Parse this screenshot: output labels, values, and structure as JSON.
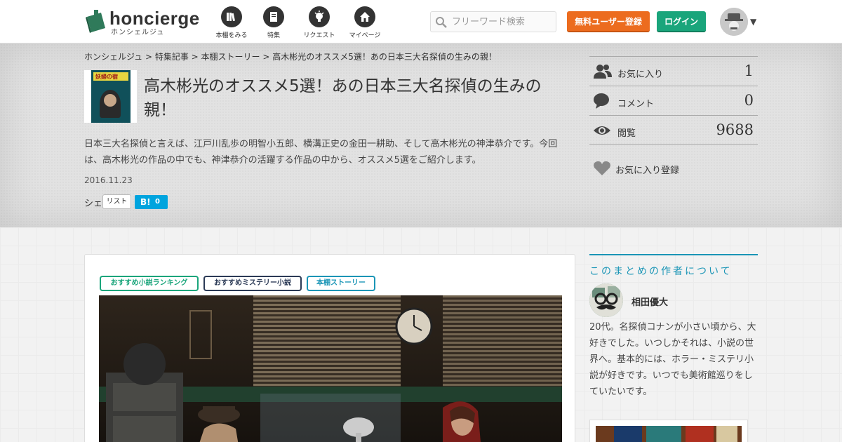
{
  "header": {
    "logo_text": "honcierge",
    "logo_sub": "ホンシェルジュ",
    "nav": [
      {
        "label": "本棚をみる",
        "icon": "books-icon"
      },
      {
        "label": "特集",
        "icon": "book-icon"
      },
      {
        "label": "リクエスト",
        "icon": "request-icon"
      },
      {
        "label": "マイページ",
        "icon": "home-icon"
      }
    ],
    "search_placeholder": "フリーワード検索",
    "register_label": "無料ユーザー登録",
    "login_label": "ログイン"
  },
  "breadcrumb": "ホンシェルジュ > 特集記事 > 本棚ストーリー > 高木彬光のオススメ5選！あの日本三大名探偵の生みの親！",
  "article": {
    "thumb_text": "妖婦の宿",
    "title": "高木彬光のオススメ5選！あの日本三大名探偵の生みの親！",
    "description": "日本三大名探偵と言えば、江戸川乱歩の明智小五郎、横溝正史の金田一耕助、そして高木彬光の神津恭介です。今回は、高木彬光の作品の中でも、神津恭介の活躍する作品の中から、オススメ5選をご紹介します。",
    "date": "2016.11.23",
    "share_label": "シェ",
    "list_label": "リスト",
    "hatena_label": "B!",
    "hatena_count": "0"
  },
  "stats": [
    {
      "label": "お気に入り",
      "value": "1",
      "icon": "users-icon"
    },
    {
      "label": "コメント",
      "value": "0",
      "icon": "comment-icon"
    },
    {
      "label": "閲覧",
      "value": "9688",
      "icon": "eye-icon"
    }
  ],
  "fav_register_label": "お気に入り登録",
  "tags": [
    "おすすめ小説ランキング",
    "おすすめミステリー小説",
    "本棚ストーリー"
  ],
  "author": {
    "heading": "このまとめの作者について",
    "name": "相田優大",
    "bio": "20代。名探偵コナンが小さい頃から、大好きでした。いつしかそれは、小説の世界へ。基本的には、ホラー・ミステリ小説が好きです。いつでも美術館巡りをしていたいです。"
  },
  "colors": {
    "register": "#ec6c1f",
    "login": "#1aa57b",
    "accent": "#1a95b6",
    "hatena": "#00a4de"
  }
}
